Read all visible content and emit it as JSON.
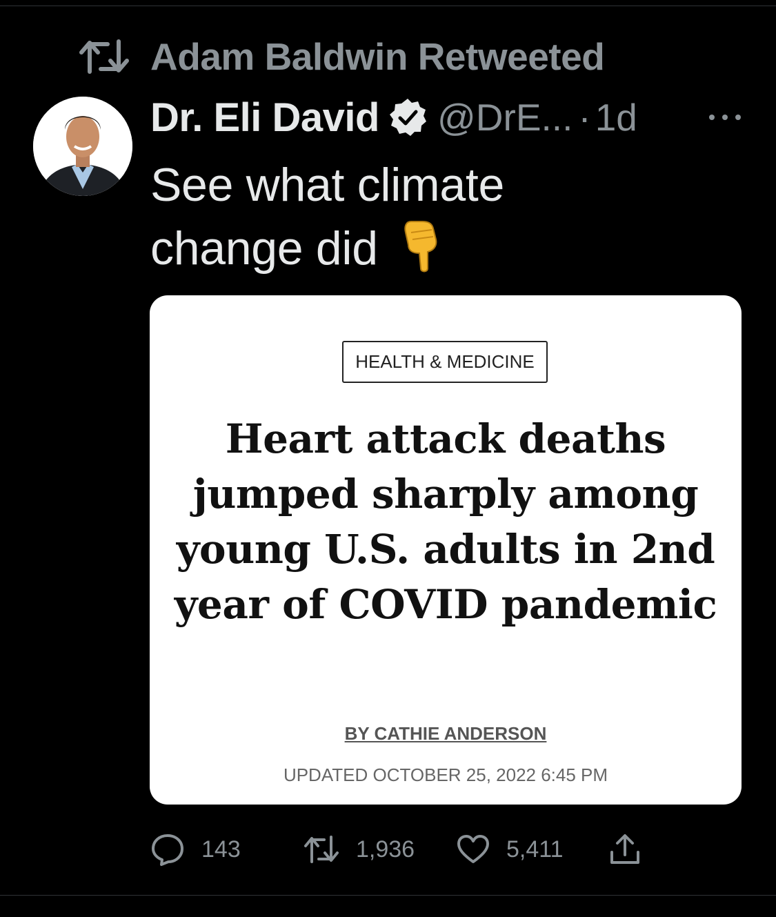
{
  "retweet": {
    "label": "Adam Baldwin Retweeted",
    "icon": "retweet-icon"
  },
  "tweet": {
    "author": "Dr. Eli David",
    "verified_icon": "verified-badge-icon",
    "handle": "@DrE...",
    "separator": "·",
    "time": "1d",
    "text_line1": "See what climate",
    "text_line2": "change did",
    "emoji": "👇"
  },
  "card": {
    "category": "HEALTH & MEDICINE",
    "headline": "Heart attack deaths jumped sharply among young U.S. adults in 2nd year of COVID pandemic",
    "byline": "BY CATHIE ANDERSON",
    "updated": "UPDATED OCTOBER 25, 2022 6:45 PM"
  },
  "actions": {
    "replies": "143",
    "retweets": "1,936",
    "likes": "5,411"
  },
  "colors": {
    "background": "#000000",
    "text": "#e7e9ea",
    "muted": "#8b9297"
  }
}
